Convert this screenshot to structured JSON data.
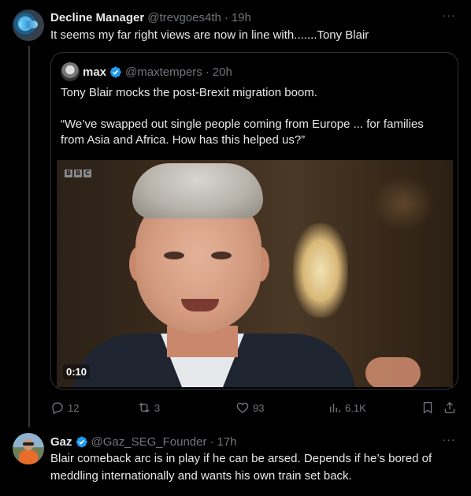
{
  "tweet1": {
    "display_name": "Decline Manager",
    "handle": "@trevgoes4th",
    "separator": "·",
    "time": "19h",
    "text": "It seems my far right views are now in line with.......Tony Blair",
    "more": "···"
  },
  "quoted": {
    "display_name": "max",
    "handle": "@maxtempers",
    "separator": "·",
    "time": "20h",
    "text_line1": "Tony Blair mocks the post-Brexit migration boom.",
    "text_line2": "“We’ve swapped out single people coming from Europe ... for families",
    "text_line3": "from Asia and Africa. How has this helped us?”",
    "video_watermark": [
      "B",
      "B",
      "C"
    ],
    "video_duration": "0:10"
  },
  "actions": {
    "replies": "12",
    "reposts": "3",
    "likes": "93",
    "views": "6.1K"
  },
  "tweet2": {
    "display_name": "Gaz",
    "handle": "@Gaz_SEG_Founder",
    "separator": "·",
    "time": "17h",
    "text_line1": "Blair comeback arc is in play if he can be arsed. Depends if he’s bored of",
    "text_line2": "meddling internationally and wants his own train set back.",
    "more": "···"
  },
  "colors": {
    "background": "#000000",
    "primary_text": "#e7e9ea",
    "secondary_text": "#71767b",
    "verified_blue": "#1d9bf0",
    "border": "#2f3336"
  }
}
